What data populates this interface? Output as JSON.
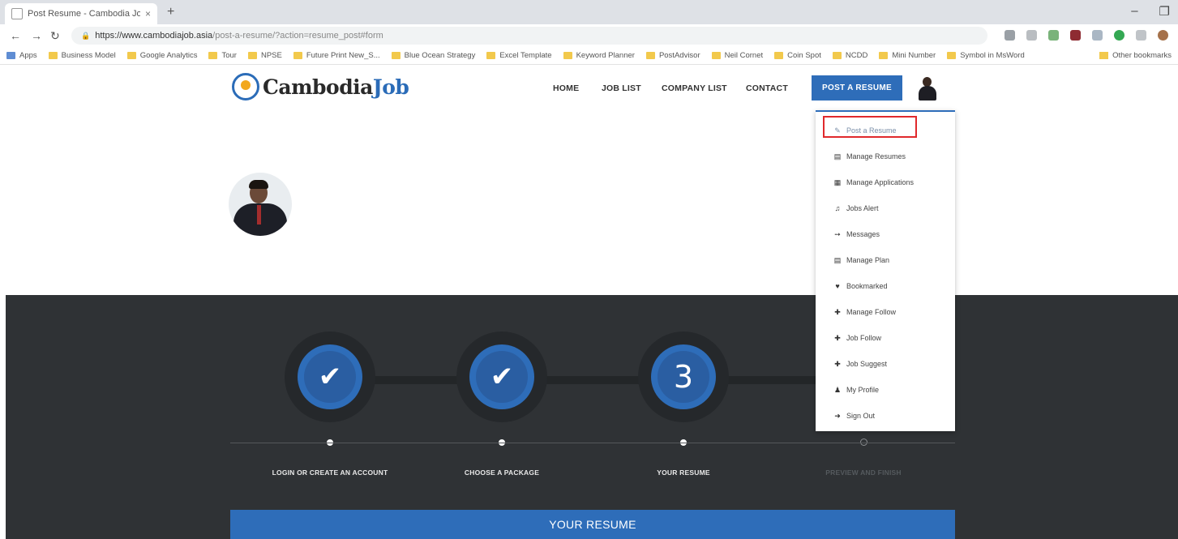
{
  "browser": {
    "tab_title": "Post Resume - Cambodia Job",
    "url_host": "https://www.cambodiajob.asia",
    "url_path": "/post-a-resume/?action=resume_post#form",
    "bookmarks": [
      "Apps",
      "Business Model",
      "Google Analytics",
      "Tour",
      "NPSE",
      "Future Print New_S...",
      "Blue Ocean Strategy",
      "Excel Template",
      "Keyword Planner",
      "PostAdvisor",
      "Neil Cornet",
      "Coin Spot",
      "NCDD",
      "Mini Number",
      "Symbol in MsWord"
    ],
    "other_bookmarks": "Other bookmarks"
  },
  "site": {
    "logo_part1": "Cambodia",
    "logo_part2": "Job",
    "nav": [
      "HOME",
      "JOB LIST",
      "COMPANY LIST",
      "CONTACT"
    ],
    "post_button": "POST A RESUME"
  },
  "dropdown": [
    {
      "icon": "✎",
      "label": "Post a Resume"
    },
    {
      "icon": "▤",
      "label": "Manage Resumes"
    },
    {
      "icon": "▦",
      "label": "Manage Applications"
    },
    {
      "icon": "♫",
      "label": "Jobs Alert"
    },
    {
      "icon": "➙",
      "label": "Messages"
    },
    {
      "icon": "▤",
      "label": "Manage Plan"
    },
    {
      "icon": "♥",
      "label": "Bookmarked"
    },
    {
      "icon": "✚",
      "label": "Manage Follow"
    },
    {
      "icon": "✚",
      "label": "Job Follow"
    },
    {
      "icon": "✚",
      "label": "Job Suggest"
    },
    {
      "icon": "♟",
      "label": "My Profile"
    },
    {
      "icon": "➜",
      "label": "Sign Out"
    }
  ],
  "steps": [
    {
      "label": "LOGIN OR CREATE AN ACCOUNT",
      "state": "done",
      "symbol": "✔"
    },
    {
      "label": "CHOOSE A PACKAGE",
      "state": "done",
      "symbol": "✔"
    },
    {
      "label": "YOUR RESUME",
      "state": "current",
      "symbol": "3"
    },
    {
      "label": "PREVIEW AND FINISH",
      "state": "upcoming",
      "symbol": ""
    }
  ],
  "section_title": "YOUR RESUME",
  "colors": {
    "primary": "#2e6db9",
    "dark": "#2f3235",
    "highlight": "#e0292c"
  }
}
